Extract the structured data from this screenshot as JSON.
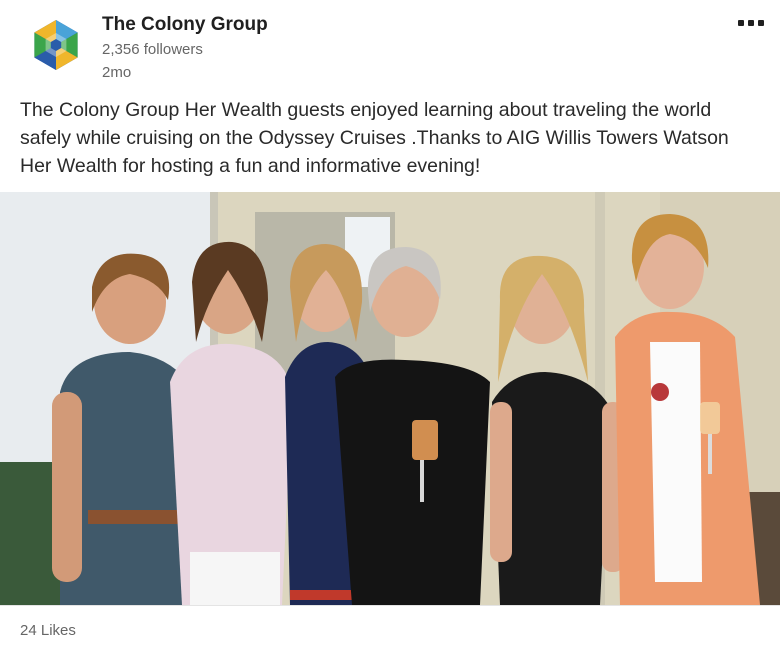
{
  "post": {
    "author": "The Colony Group",
    "followers": "2,356 followers",
    "time": "2mo",
    "text": "The Colony Group Her Wealth guests enjoyed learning about traveling the world safely while cruising on the Odyssey Cruises .Thanks to AIG  Willis Towers Watson Her Wealth for hosting a fun and informative evening!",
    "likes": "24 Likes"
  },
  "icons": {
    "logo": "colony-group-logo",
    "menu": "more-options-icon"
  },
  "colors": {
    "name": "#202020",
    "meta": "#666666",
    "body_text": "#2a2a2a",
    "logo_blue": "#2a5caa",
    "logo_green": "#3aa54a",
    "logo_yellow": "#f0b62b",
    "logo_light_blue": "#4aa3d8"
  }
}
